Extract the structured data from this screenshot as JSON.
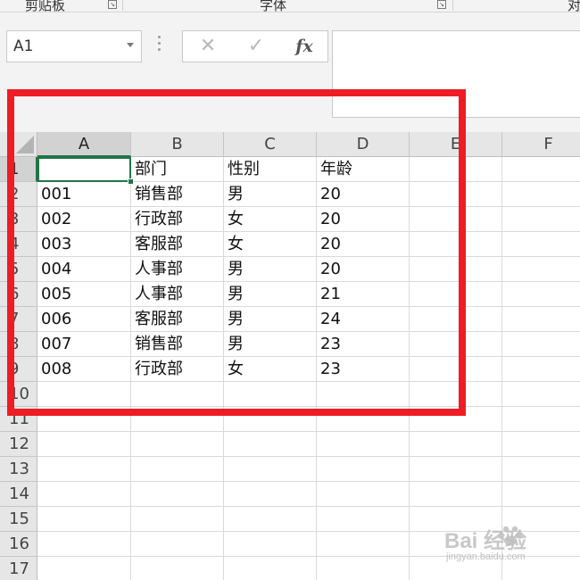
{
  "ribbon": {
    "groups": [
      {
        "label": "剪贴板"
      },
      {
        "label": "字体"
      },
      {
        "label": "对"
      }
    ]
  },
  "formula_bar": {
    "name_box": "A1",
    "cancel_symbol": "✕",
    "enter_symbol": "✓",
    "fx_label": "fx",
    "content": ""
  },
  "sheet": {
    "columns": [
      "A",
      "B",
      "C",
      "D",
      "E",
      "F"
    ],
    "rows": [
      "1",
      "2",
      "3",
      "4",
      "5",
      "6",
      "7",
      "8",
      "9",
      "10",
      "11",
      "12",
      "13",
      "14",
      "15",
      "16",
      "17"
    ],
    "data": [
      [
        "",
        "部门",
        "性别",
        "年龄"
      ],
      [
        "001",
        "销售部",
        "男",
        "20"
      ],
      [
        "002",
        "行政部",
        "女",
        "20"
      ],
      [
        "003",
        "客服部",
        "女",
        "20"
      ],
      [
        "004",
        "人事部",
        "男",
        "20"
      ],
      [
        "005",
        "人事部",
        "男",
        "21"
      ],
      [
        "006",
        "客服部",
        "男",
        "24"
      ],
      [
        "007",
        "销售部",
        "男",
        "23"
      ],
      [
        "008",
        "行政部",
        "女",
        "23"
      ]
    ],
    "active_cell": "A1"
  },
  "annotation": {
    "highlight_color": "#ee1c25"
  },
  "theme": {
    "accent": "#217346"
  },
  "watermark": {
    "logo": "Bai  经验",
    "url": "jingyan.baidu.com"
  }
}
